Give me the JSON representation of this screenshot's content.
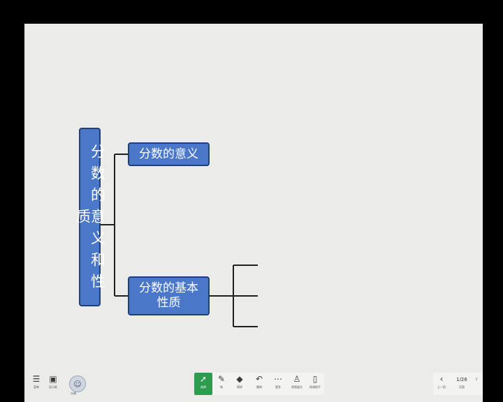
{
  "mindmap": {
    "root": "分数的意义和性质",
    "branches": [
      {
        "label": "分数的意义"
      },
      {
        "label": "分数的基本性质"
      }
    ]
  },
  "toolbar": {
    "menu": {
      "icon": "menu-icon",
      "label": "菜单"
    },
    "display": {
      "icon": "display-icon",
      "label": "显示框"
    },
    "avatar": {
      "icon": "user-avatar-icon",
      "label": "头像"
    },
    "tools": [
      {
        "name": "select",
        "icon": "pointer-icon",
        "label": "选择"
      },
      {
        "name": "pen",
        "icon": "pen-icon",
        "label": "笔"
      },
      {
        "name": "eraser",
        "icon": "eraser-icon",
        "label": "擦除"
      },
      {
        "name": "undo",
        "icon": "undo-icon",
        "label": "撤销"
      },
      {
        "name": "more",
        "icon": "more-icon",
        "label": "更多"
      },
      {
        "name": "stamp",
        "icon": "stamp-icon",
        "label": "视频展台"
      },
      {
        "name": "phone",
        "icon": "phone-icon",
        "label": "授课助手"
      }
    ],
    "page": {
      "prev_label": "上一页",
      "counter": "1/26",
      "counter_label": "页面"
    }
  },
  "colors": {
    "node_fill": "#4a77c8",
    "node_border": "#1e3f7a",
    "active_tool": "#2e9b4f",
    "background": "#ebebea"
  }
}
